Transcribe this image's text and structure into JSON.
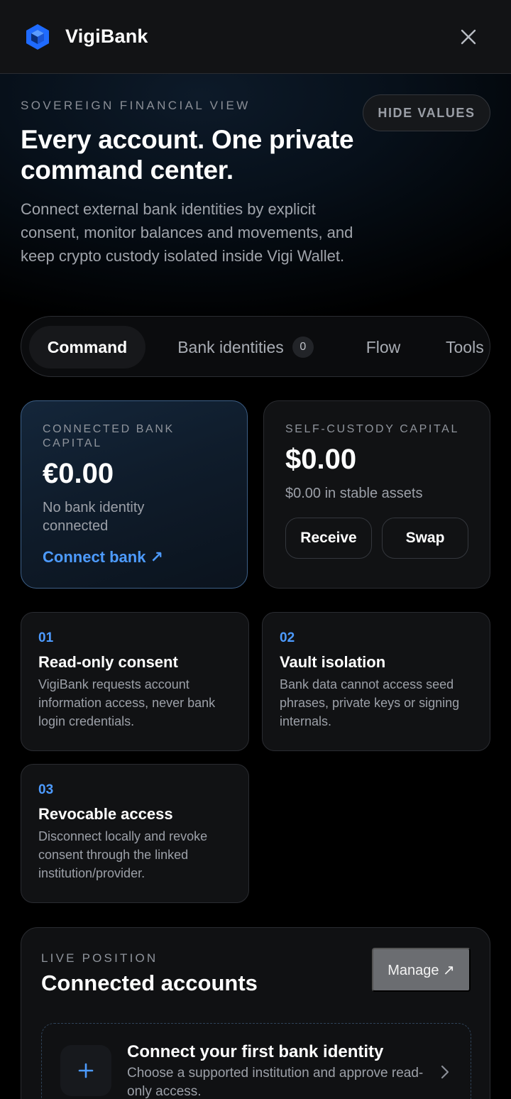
{
  "app": {
    "brand": "VigiBank"
  },
  "hero": {
    "eyebrow": "SOVEREIGN FINANCIAL VIEW",
    "hide_values": "HIDE VALUES",
    "title": "Every account. One private command center.",
    "subtitle": "Connect external bank identities by explicit consent, monitor balances and movements, and keep crypto custody isolated inside Vigi Wallet."
  },
  "tabs": [
    {
      "label": "Command",
      "active": true
    },
    {
      "label": "Bank identities",
      "badge": "0"
    },
    {
      "label": "Flow"
    },
    {
      "label": "Tools"
    }
  ],
  "bank_card": {
    "label": "CONNECTED BANK CAPITAL",
    "amount": "€0.00",
    "status": "No bank identity connected",
    "link": "Connect bank ↗"
  },
  "custody_card": {
    "label": "SELF-CUSTODY CAPITAL",
    "amount": "$0.00",
    "stable": "$0.00 in stable assets",
    "receive": "Receive",
    "swap": "Swap"
  },
  "features": [
    {
      "num": "01",
      "title": "Read-only consent",
      "desc": "VigiBank requests account information access, never bank login credentials."
    },
    {
      "num": "02",
      "title": "Vault isolation",
      "desc": "Bank data cannot access seed phrases, private keys or signing internals."
    },
    {
      "num": "03",
      "title": "Revocable access",
      "desc": "Disconnect locally and revoke consent through the linked institution/provider."
    }
  ],
  "live": {
    "eyebrow": "LIVE POSITION",
    "title": "Connected accounts",
    "manage": "Manage ↗",
    "empty_title": "Connect your first bank identity",
    "empty_desc": "Choose a supported institution and approve read-only access."
  },
  "colors": {
    "accent": "#4d9bff",
    "logo": "#1f6bff",
    "background": "#000000"
  }
}
